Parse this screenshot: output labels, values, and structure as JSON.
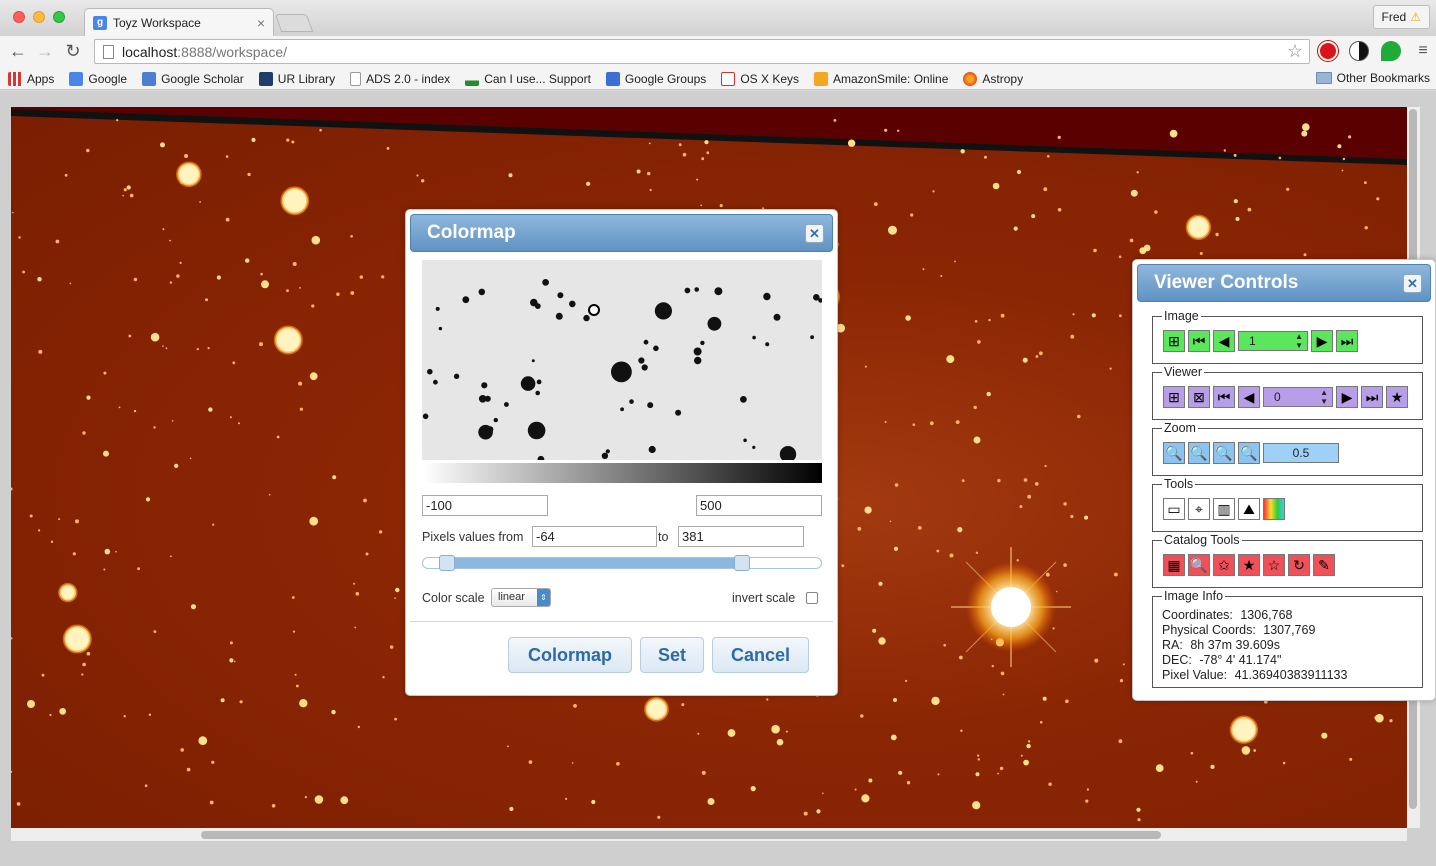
{
  "browser": {
    "tab_title": "Toyz Workspace",
    "profile_name": "Fred",
    "url_host": "localhost",
    "url_rest": ":8888/workspace/"
  },
  "bookmarks": [
    {
      "label": "Apps",
      "icon": "apps-icon"
    },
    {
      "label": "Google",
      "icon": "google-icon"
    },
    {
      "label": "Google Scholar",
      "icon": "scholar-icon"
    },
    {
      "label": "UR Library",
      "icon": "library-icon"
    },
    {
      "label": "ADS 2.0 - index",
      "icon": "page-icon"
    },
    {
      "label": "Can I use... Support",
      "icon": "caniuse-icon"
    },
    {
      "label": "Google Groups",
      "icon": "groups-icon"
    },
    {
      "label": "OS X Keys",
      "icon": "keys-icon"
    },
    {
      "label": "AmazonSmile: Online",
      "icon": "amazon-icon"
    },
    {
      "label": "Astropy",
      "icon": "astropy-icon"
    }
  ],
  "other_bookmarks": "Other Bookmarks",
  "colormap": {
    "title": "Colormap",
    "min_value": "-100",
    "max_value": "500",
    "pixels_from_label": "Pixels values from",
    "pixels_from": "-64",
    "to_label": "to",
    "pixels_to": "381",
    "slider_low": -64,
    "slider_high": 381,
    "slider_min": -100,
    "slider_max": 500,
    "color_scale_label": "Color scale",
    "color_scale_value": "linear",
    "invert_label": "invert scale",
    "invert_checked": false,
    "buttons": {
      "colormap": "Colormap",
      "set": "Set",
      "cancel": "Cancel"
    }
  },
  "controls": {
    "title": "Viewer Controls",
    "image_label": "Image",
    "image_index": "1",
    "viewer_label": "Viewer",
    "viewer_index": "0",
    "zoom_label": "Zoom",
    "zoom_value": "0.5",
    "tools_label": "Tools",
    "catalog_label": "Catalog Tools",
    "info_label": "Image Info",
    "info": {
      "coordinates_label": "Coordinates:",
      "coordinates": "1306,768",
      "physical_label": "Physical Coords:",
      "physical": "1307,769",
      "ra_label": "RA:",
      "ra": "8h 37m 39.609s",
      "dec_label": "DEC:",
      "dec": "-78° 4' 41.174\"",
      "pixel_label": "Pixel Value:",
      "pixel": "41.36940383911133"
    }
  },
  "colors": {
    "accent": "#5f93c4",
    "image_bg": "#8b2604",
    "image_edge": "#5a0000"
  }
}
